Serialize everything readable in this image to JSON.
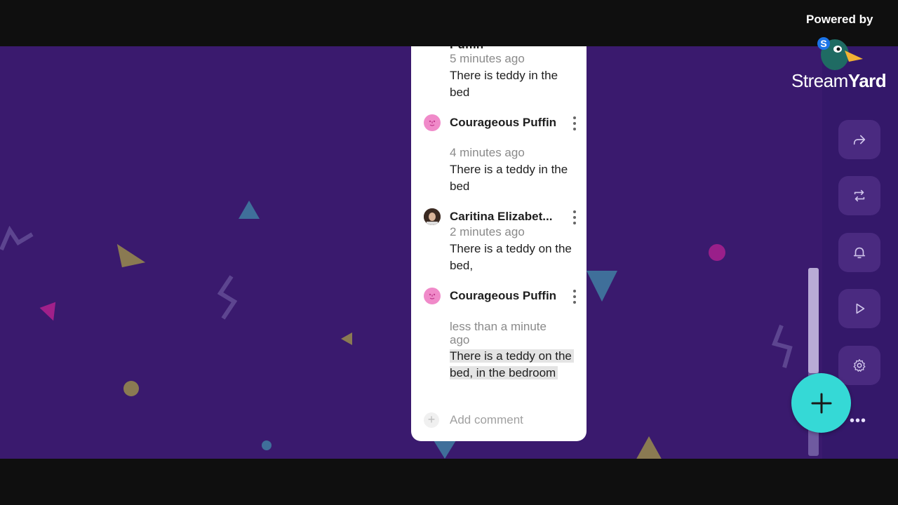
{
  "brand": {
    "powered_by": "Powered by",
    "logo_text_light": "Stream",
    "logo_text_bold": "Yard"
  },
  "comments": {
    "top_partial": {
      "name_fragment": "Puffin",
      "time": "5 minutes ago",
      "text": "There is teddy in the bed"
    },
    "items": [
      {
        "name": "Courageous Puffin",
        "time": "4 minutes ago",
        "text": "There is a teddy in the bed",
        "avatar": "puffin-face-icon"
      },
      {
        "name": "Caritina Elizabet...",
        "time": "2 minutes ago",
        "text": "There is a teddy on the bed,",
        "avatar": "user-photo"
      },
      {
        "name": "Courageous Puffin",
        "time": "less than a minute ago",
        "text": "There is a teddy on the bed, in the bedroom",
        "avatar": "puffin-face-icon"
      }
    ],
    "add_placeholder": "Add comment"
  },
  "rail": {
    "buttons": [
      "share-icon",
      "repeat-icon",
      "bell-icon",
      "play-icon",
      "gear-icon"
    ]
  },
  "colors": {
    "stage_bg": "#3a1a6e",
    "rail_bg": "#34186a",
    "fab_bg": "#35d9d6",
    "puffin_avatar": "#f08ac9"
  }
}
